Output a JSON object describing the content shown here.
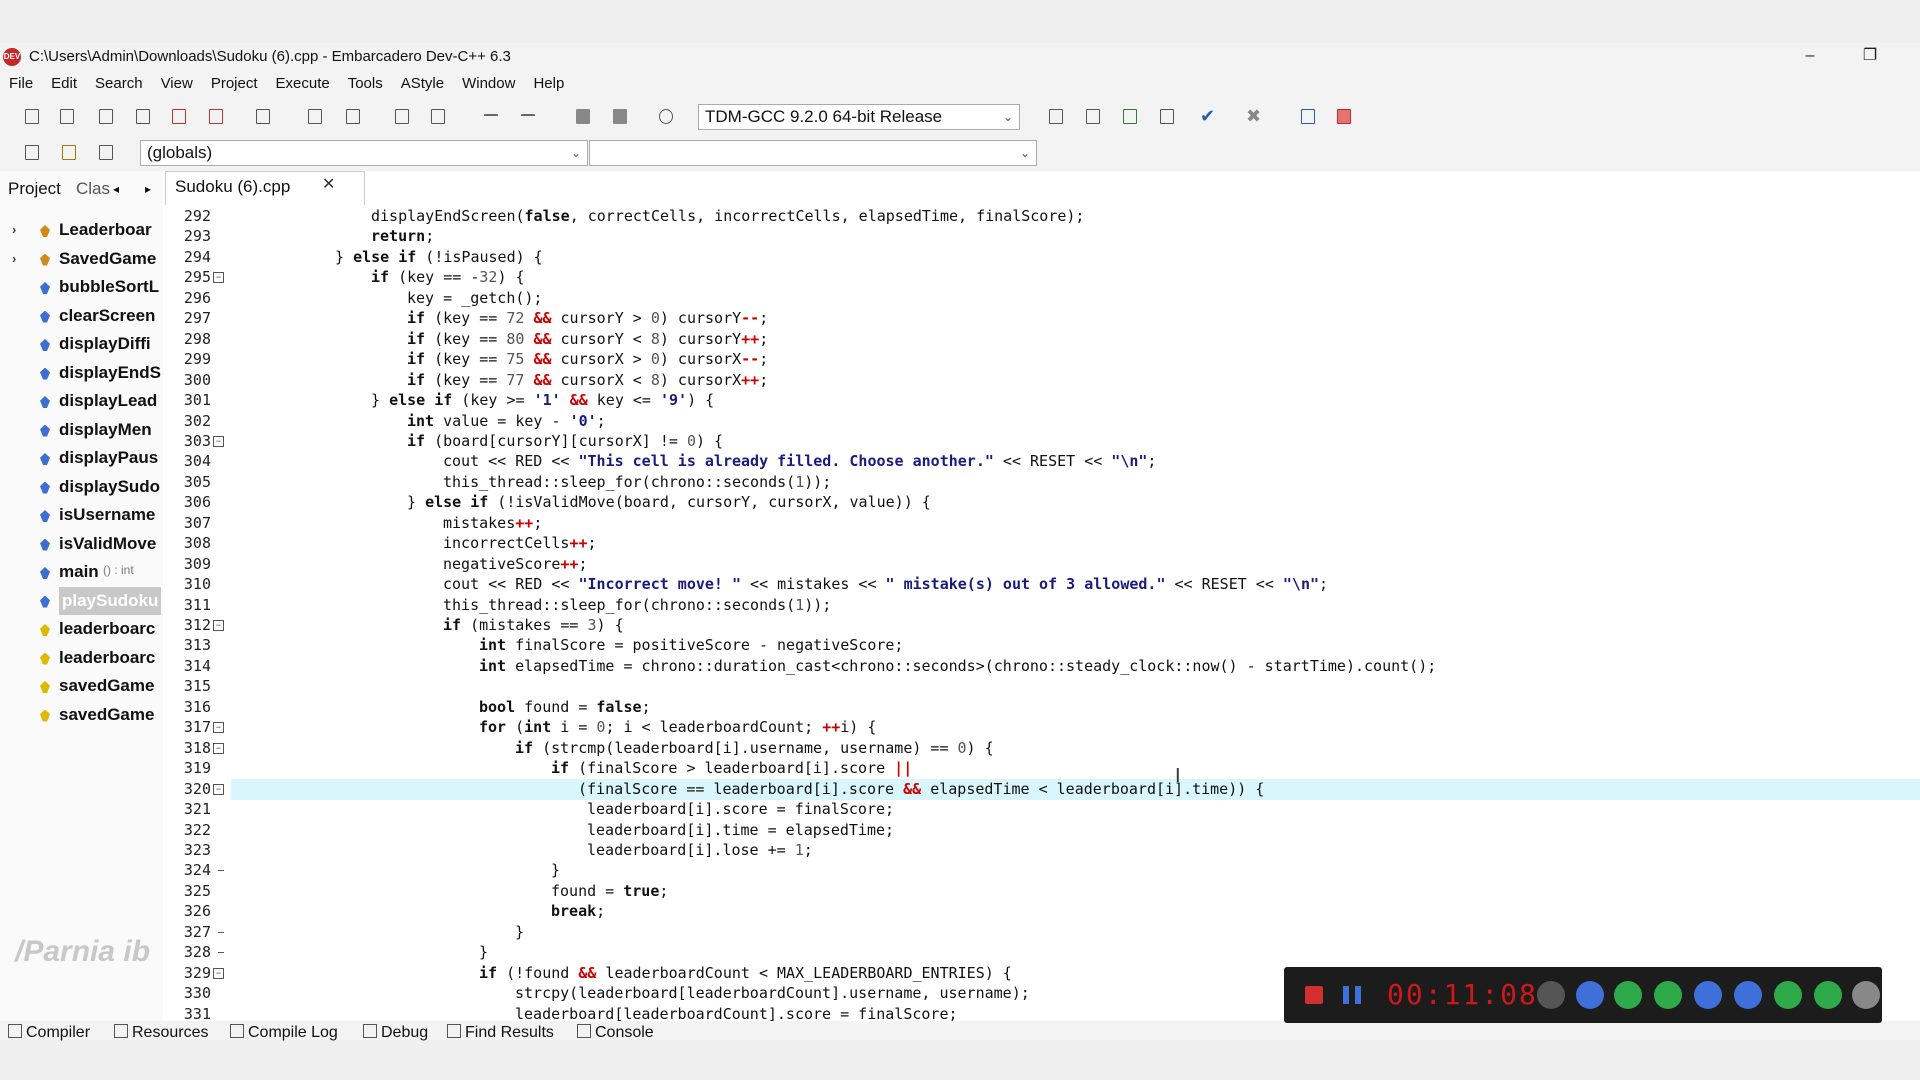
{
  "window": {
    "title": "C:\\Users\\Admin\\Downloads\\Sudoku (6).cpp - Embarcadero Dev-C++ 6.3",
    "icon": "devcpp-icon",
    "minimize": "–",
    "restore": "❐"
  },
  "menu": [
    "File",
    "Edit",
    "Search",
    "View",
    "Project",
    "Execute",
    "Tools",
    "AStyle",
    "Window",
    "Help"
  ],
  "toolbar": {
    "compiler_select": "TDM-GCC 9.2.0 64-bit Release",
    "scope_select": "(globals)",
    "member_select": ""
  },
  "left_panel": {
    "tabs": [
      "Project",
      "Clas"
    ],
    "items": [
      {
        "label": "Leaderboar",
        "kind": "struct",
        "expandable": true
      },
      {
        "label": "SavedGame",
        "kind": "struct",
        "expandable": true
      },
      {
        "label": "bubbleSortL",
        "kind": "function"
      },
      {
        "label": "clearScreen",
        "kind": "function"
      },
      {
        "label": "displayDiffi",
        "kind": "function"
      },
      {
        "label": "displayEndS",
        "kind": "function"
      },
      {
        "label": "displayLead",
        "kind": "function"
      },
      {
        "label": "displayMen",
        "kind": "function"
      },
      {
        "label": "displayPaus",
        "kind": "function"
      },
      {
        "label": "displaySudo",
        "kind": "function"
      },
      {
        "label": "isUsername",
        "kind": "function"
      },
      {
        "label": "isValidMove",
        "kind": "function"
      },
      {
        "label": "main",
        "kind": "function",
        "suffix": "() : int"
      },
      {
        "label": "playSudoku",
        "kind": "function",
        "selected": true
      },
      {
        "label": "leaderboarc",
        "kind": "variable"
      },
      {
        "label": "leaderboarc",
        "kind": "variable"
      },
      {
        "label": "savedGame",
        "kind": "variable"
      },
      {
        "label": "savedGame",
        "kind": "variable"
      }
    ]
  },
  "editor": {
    "file_tab": "Sudoku (6).cpp",
    "close": "✕",
    "highlight_line": 320,
    "lines": [
      {
        "n": 292,
        "indent": 12,
        "code": "displayEndScreen(false, correctCells, incorrectCells, elapsedTime, finalScore);"
      },
      {
        "n": 293,
        "indent": 12,
        "code": "return;"
      },
      {
        "n": 294,
        "indent": 8,
        "code": "} else if (!isPaused) {"
      },
      {
        "n": 295,
        "indent": 12,
        "code": "if (key == -32) {",
        "fold": "open"
      },
      {
        "n": 296,
        "indent": 16,
        "code": "key = _getch();"
      },
      {
        "n": 297,
        "indent": 16,
        "code": "if (key == 72 && cursorY > 0) cursorY--;"
      },
      {
        "n": 298,
        "indent": 16,
        "code": "if (key == 80 && cursorY < 8) cursorY++;"
      },
      {
        "n": 299,
        "indent": 16,
        "code": "if (key == 75 && cursorX > 0) cursorX--;"
      },
      {
        "n": 300,
        "indent": 16,
        "code": "if (key == 77 && cursorX < 8) cursorX++;"
      },
      {
        "n": 301,
        "indent": 12,
        "code": "} else if (key >= '1' && key <= '9') {"
      },
      {
        "n": 302,
        "indent": 16,
        "code": "int value = key - '0';"
      },
      {
        "n": 303,
        "indent": 16,
        "code": "if (board[cursorY][cursorX] != 0) {",
        "fold": "open"
      },
      {
        "n": 304,
        "indent": 20,
        "code": "cout << RED << \"This cell is already filled. Choose another.\" << RESET << \"\\n\";"
      },
      {
        "n": 305,
        "indent": 20,
        "code": "this_thread::sleep_for(chrono::seconds(1));"
      },
      {
        "n": 306,
        "indent": 16,
        "code": "} else if (!isValidMove(board, cursorY, cursorX, value)) {"
      },
      {
        "n": 307,
        "indent": 20,
        "code": "mistakes++;"
      },
      {
        "n": 308,
        "indent": 20,
        "code": "incorrectCells++;"
      },
      {
        "n": 309,
        "indent": 20,
        "code": "negativeScore++;"
      },
      {
        "n": 310,
        "indent": 20,
        "code": "cout << RED << \"Incorrect move! \" << mistakes << \" mistake(s) out of 3 allowed.\" << RESET << \"\\n\";"
      },
      {
        "n": 311,
        "indent": 20,
        "code": "this_thread::sleep_for(chrono::seconds(1));"
      },
      {
        "n": 312,
        "indent": 20,
        "code": "if (mistakes == 3) {",
        "fold": "open"
      },
      {
        "n": 313,
        "indent": 24,
        "code": "int finalScore = positiveScore - negativeScore;"
      },
      {
        "n": 314,
        "indent": 24,
        "code": "int elapsedTime = chrono::duration_cast<chrono::seconds>(chrono::steady_clock::now() - startTime).count();"
      },
      {
        "n": 315,
        "indent": 0,
        "code": ""
      },
      {
        "n": 316,
        "indent": 24,
        "code": "bool found = false;"
      },
      {
        "n": 317,
        "indent": 24,
        "code": "for (int i = 0; i < leaderboardCount; ++i) {",
        "fold": "open"
      },
      {
        "n": 318,
        "indent": 28,
        "code": "if (strcmp(leaderboard[i].username, username) == 0) {",
        "fold": "open"
      },
      {
        "n": 319,
        "indent": 32,
        "code": "if (finalScore > leaderboard[i].score ||"
      },
      {
        "n": 320,
        "indent": 35,
        "code": "(finalScore == leaderboard[i].score && elapsedTime < leaderboard[i].time)) {",
        "fold": "open"
      },
      {
        "n": 321,
        "indent": 36,
        "code": "leaderboard[i].score = finalScore;"
      },
      {
        "n": 322,
        "indent": 36,
        "code": "leaderboard[i].time = elapsedTime;"
      },
      {
        "n": 323,
        "indent": 36,
        "code": "leaderboard[i].lose += 1;"
      },
      {
        "n": 324,
        "indent": 32,
        "code": "}",
        "fold": "end"
      },
      {
        "n": 325,
        "indent": 32,
        "code": "found = true;"
      },
      {
        "n": 326,
        "indent": 32,
        "code": "break;"
      },
      {
        "n": 327,
        "indent": 28,
        "code": "}",
        "fold": "end"
      },
      {
        "n": 328,
        "indent": 24,
        "code": "}",
        "fold": "end"
      },
      {
        "n": 329,
        "indent": 24,
        "code": "if (!found && leaderboardCount < MAX_LEADERBOARD_ENTRIES) {",
        "fold": "open"
      },
      {
        "n": 330,
        "indent": 28,
        "code": "strcpy(leaderboard[leaderboardCount].username, username);"
      },
      {
        "n": 331,
        "indent": 28,
        "code": "leaderboard[leaderboardCount].score = finalScore;"
      }
    ]
  },
  "bottom_tabs": [
    "Compiler",
    "Resources",
    "Compile Log",
    "Debug",
    "Find Results",
    "Console"
  ],
  "recorder": {
    "timer": "00:11:08",
    "colors": {
      "stop": "#d32f2f",
      "pause": "#3f6fd9",
      "green": "#2eaa4a",
      "timer": "#d01818"
    }
  },
  "watermark": "/Parnia ib"
}
